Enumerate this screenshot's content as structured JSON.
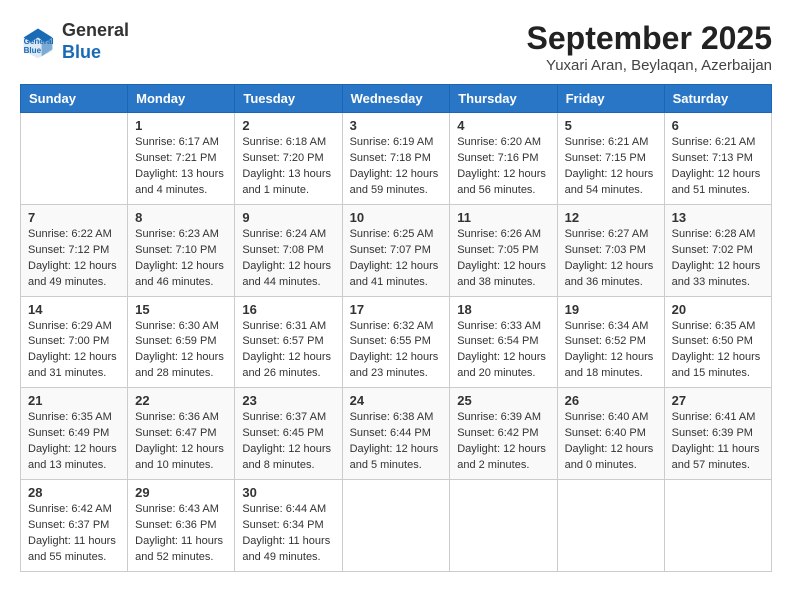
{
  "header": {
    "logo_general": "General",
    "logo_blue": "Blue",
    "main_title": "September 2025",
    "sub_title": "Yuxari Aran, Beylaqan, Azerbaijan"
  },
  "columns": [
    "Sunday",
    "Monday",
    "Tuesday",
    "Wednesday",
    "Thursday",
    "Friday",
    "Saturday"
  ],
  "weeks": [
    [
      {
        "day": "",
        "info": ""
      },
      {
        "day": "1",
        "info": "Sunrise: 6:17 AM\nSunset: 7:21 PM\nDaylight: 13 hours\nand 4 minutes."
      },
      {
        "day": "2",
        "info": "Sunrise: 6:18 AM\nSunset: 7:20 PM\nDaylight: 13 hours\nand 1 minute."
      },
      {
        "day": "3",
        "info": "Sunrise: 6:19 AM\nSunset: 7:18 PM\nDaylight: 12 hours\nand 59 minutes."
      },
      {
        "day": "4",
        "info": "Sunrise: 6:20 AM\nSunset: 7:16 PM\nDaylight: 12 hours\nand 56 minutes."
      },
      {
        "day": "5",
        "info": "Sunrise: 6:21 AM\nSunset: 7:15 PM\nDaylight: 12 hours\nand 54 minutes."
      },
      {
        "day": "6",
        "info": "Sunrise: 6:21 AM\nSunset: 7:13 PM\nDaylight: 12 hours\nand 51 minutes."
      }
    ],
    [
      {
        "day": "7",
        "info": "Sunrise: 6:22 AM\nSunset: 7:12 PM\nDaylight: 12 hours\nand 49 minutes."
      },
      {
        "day": "8",
        "info": "Sunrise: 6:23 AM\nSunset: 7:10 PM\nDaylight: 12 hours\nand 46 minutes."
      },
      {
        "day": "9",
        "info": "Sunrise: 6:24 AM\nSunset: 7:08 PM\nDaylight: 12 hours\nand 44 minutes."
      },
      {
        "day": "10",
        "info": "Sunrise: 6:25 AM\nSunset: 7:07 PM\nDaylight: 12 hours\nand 41 minutes."
      },
      {
        "day": "11",
        "info": "Sunrise: 6:26 AM\nSunset: 7:05 PM\nDaylight: 12 hours\nand 38 minutes."
      },
      {
        "day": "12",
        "info": "Sunrise: 6:27 AM\nSunset: 7:03 PM\nDaylight: 12 hours\nand 36 minutes."
      },
      {
        "day": "13",
        "info": "Sunrise: 6:28 AM\nSunset: 7:02 PM\nDaylight: 12 hours\nand 33 minutes."
      }
    ],
    [
      {
        "day": "14",
        "info": "Sunrise: 6:29 AM\nSunset: 7:00 PM\nDaylight: 12 hours\nand 31 minutes."
      },
      {
        "day": "15",
        "info": "Sunrise: 6:30 AM\nSunset: 6:59 PM\nDaylight: 12 hours\nand 28 minutes."
      },
      {
        "day": "16",
        "info": "Sunrise: 6:31 AM\nSunset: 6:57 PM\nDaylight: 12 hours\nand 26 minutes."
      },
      {
        "day": "17",
        "info": "Sunrise: 6:32 AM\nSunset: 6:55 PM\nDaylight: 12 hours\nand 23 minutes."
      },
      {
        "day": "18",
        "info": "Sunrise: 6:33 AM\nSunset: 6:54 PM\nDaylight: 12 hours\nand 20 minutes."
      },
      {
        "day": "19",
        "info": "Sunrise: 6:34 AM\nSunset: 6:52 PM\nDaylight: 12 hours\nand 18 minutes."
      },
      {
        "day": "20",
        "info": "Sunrise: 6:35 AM\nSunset: 6:50 PM\nDaylight: 12 hours\nand 15 minutes."
      }
    ],
    [
      {
        "day": "21",
        "info": "Sunrise: 6:35 AM\nSunset: 6:49 PM\nDaylight: 12 hours\nand 13 minutes."
      },
      {
        "day": "22",
        "info": "Sunrise: 6:36 AM\nSunset: 6:47 PM\nDaylight: 12 hours\nand 10 minutes."
      },
      {
        "day": "23",
        "info": "Sunrise: 6:37 AM\nSunset: 6:45 PM\nDaylight: 12 hours\nand 8 minutes."
      },
      {
        "day": "24",
        "info": "Sunrise: 6:38 AM\nSunset: 6:44 PM\nDaylight: 12 hours\nand 5 minutes."
      },
      {
        "day": "25",
        "info": "Sunrise: 6:39 AM\nSunset: 6:42 PM\nDaylight: 12 hours\nand 2 minutes."
      },
      {
        "day": "26",
        "info": "Sunrise: 6:40 AM\nSunset: 6:40 PM\nDaylight: 12 hours\nand 0 minutes."
      },
      {
        "day": "27",
        "info": "Sunrise: 6:41 AM\nSunset: 6:39 PM\nDaylight: 11 hours\nand 57 minutes."
      }
    ],
    [
      {
        "day": "28",
        "info": "Sunrise: 6:42 AM\nSunset: 6:37 PM\nDaylight: 11 hours\nand 55 minutes."
      },
      {
        "day": "29",
        "info": "Sunrise: 6:43 AM\nSunset: 6:36 PM\nDaylight: 11 hours\nand 52 minutes."
      },
      {
        "day": "30",
        "info": "Sunrise: 6:44 AM\nSunset: 6:34 PM\nDaylight: 11 hours\nand 49 minutes."
      },
      {
        "day": "",
        "info": ""
      },
      {
        "day": "",
        "info": ""
      },
      {
        "day": "",
        "info": ""
      },
      {
        "day": "",
        "info": ""
      }
    ]
  ]
}
